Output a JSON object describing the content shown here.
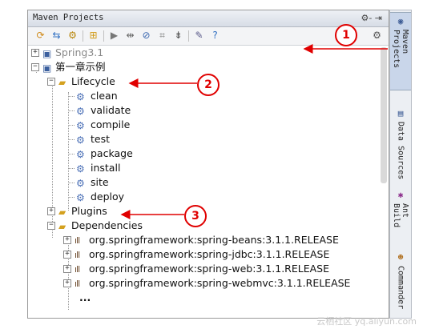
{
  "window": {
    "title": "Maven Projects",
    "title_tools": "⚙- ⇥"
  },
  "toolbar": {
    "icons": [
      "refresh-icon",
      "reimport-icon",
      "generate-sources-icon",
      "add-icon",
      "run-icon",
      "toggle-offline-icon",
      "skip-tests-icon",
      "show-dependencies-icon",
      "collapse-all-icon",
      "settings-icon",
      "help-icon",
      "gear-icon"
    ]
  },
  "tree": {
    "project1": "Spring3.1",
    "project2": "第一章示例",
    "lifecycle": "Lifecycle",
    "lifecycle_items": [
      "clean",
      "validate",
      "compile",
      "test",
      "package",
      "install",
      "site",
      "deploy"
    ],
    "plugins": "Plugins",
    "dependencies": "Dependencies",
    "dependency_items": [
      "org.springframework:spring-beans:3.1.1.RELEASE",
      "org.springframework:spring-jdbc:3.1.1.RELEASE",
      "org.springframework:spring-web:3.1.1.RELEASE",
      "org.springframework:spring-webmvc:3.1.1.RELEASE"
    ],
    "more": "..."
  },
  "sidebar": {
    "tabs": [
      "Maven Projects",
      "Data Sources",
      "Ant Build",
      "Commander"
    ]
  },
  "callouts": [
    "1",
    "2",
    "3"
  ],
  "colors": {
    "callout": "#e00000",
    "tab_active": "#c9d6ea"
  },
  "watermark": "云栖社区 yq.aliyun.com"
}
